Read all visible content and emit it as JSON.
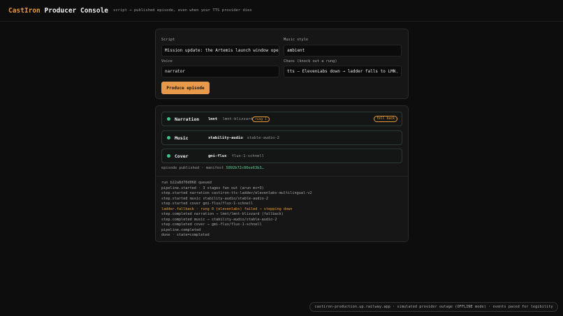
{
  "header": {
    "brand_part1": "CastIron",
    "brand_part2": "Producer Console",
    "tagline": "script → published episode, even when your TTS provider dies"
  },
  "form": {
    "script_label": "Script",
    "script_value": "Mission update: the Artemis launch window ope",
    "music_label": "Music style",
    "music_value": "ambient",
    "voice_label": "Voice",
    "voice_value": "narrator",
    "chaos_label": "Chaos (knock out a rung)",
    "chaos_value": "tts — ElevenLabs down → ladder falls to LMN",
    "produce_label": "Produce episode"
  },
  "stages": [
    {
      "name": "Narration",
      "provider": "lmnt",
      "model": "lmnt-blizzard",
      "rung": "rung 1",
      "status": "fell back"
    },
    {
      "name": "Music",
      "provider": "stability-audio",
      "model": "stable-audio-2"
    },
    {
      "name": "Cover",
      "provider": "gmi-flux",
      "model": "flux-1-schnell"
    }
  ],
  "published": {
    "text": "episode published · manifest",
    "hash": "5892b72c86ee63b3…"
  },
  "log": [
    {
      "text": "run b22a8d70d068 queued",
      "type": "normal"
    },
    {
      "text": "pipeline.started · 3 stages fan out (arun mc=3)",
      "type": "normal"
    },
    {
      "text": "step.started  narration castiron-tts-ladder/elevenlabs-multilingual-v2",
      "type": "normal"
    },
    {
      "text": "step.started  music stability-audio/stable-audio-2",
      "type": "normal"
    },
    {
      "text": "step.started  cover gmi-flux/flux-1-schnell",
      "type": "normal"
    },
    {
      "text": "ladder.fallback · rung 0 (elevenlabs) failed → stepping down",
      "type": "warn"
    },
    {
      "text": "step.completed narration → lmnt/lmnt-blizzard (fallback)",
      "type": "normal"
    },
    {
      "text": "step.completed music → stability-audio/stable-audio-2",
      "type": "normal"
    },
    {
      "text": "step.completed cover → gmi-flux/flux-1-schnell",
      "type": "normal"
    },
    {
      "text": "pipeline.completed",
      "type": "normal"
    },
    {
      "text": "done · state=completed",
      "type": "normal"
    }
  ],
  "footer": {
    "text": "castiron-production.up.railway.app · simulated provider outage (OFFLINE mode) · events paced for legibility"
  },
  "colors": {
    "accent": "#e89a3c",
    "success": "#3ec48a",
    "background": "#0d0d0d"
  }
}
